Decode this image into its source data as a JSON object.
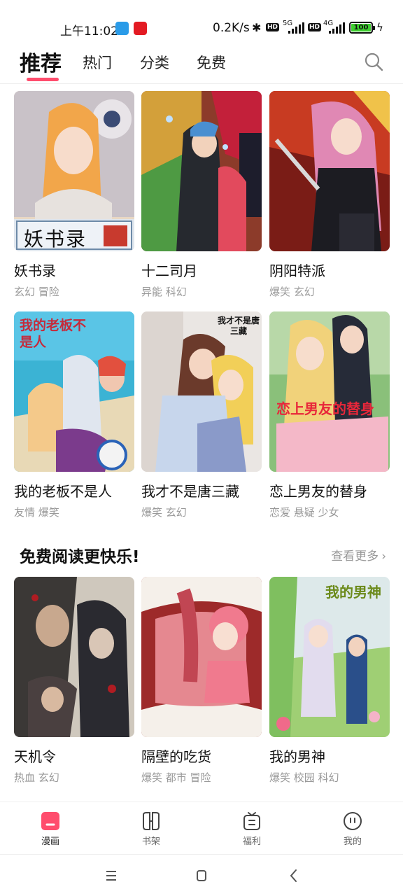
{
  "status_bar": {
    "time": "上午11:02",
    "net_speed": "0.2K/s",
    "battery": "100",
    "network_1": "5G",
    "network_2": "4G",
    "hd": "HD"
  },
  "tabs": {
    "items": [
      "推荐",
      "热门",
      "分类",
      "免费"
    ],
    "active": "推荐"
  },
  "grid": [
    {
      "title": "妖书录",
      "tags": "玄幻 冒险",
      "cover_text": "妖书录"
    },
    {
      "title": "十二司月",
      "tags": "异能 科幻",
      "cover_text": ""
    },
    {
      "title": "阴阳特派",
      "tags": "爆笑 玄幻",
      "cover_text": ""
    },
    {
      "title": "我的老板不是人",
      "tags": "友情 爆笑",
      "cover_text": "我的老板不是人"
    },
    {
      "title": "我才不是唐三藏",
      "tags": "爆笑 玄幻",
      "cover_text": "我才不是唐三藏"
    },
    {
      "title": "恋上男友的替身",
      "tags": "恋爱 悬疑 少女",
      "cover_text": "恋上男友的替身"
    }
  ],
  "free_section": {
    "title": "免费阅读更快乐!",
    "more": "查看更多",
    "items": [
      {
        "title": "天机令",
        "tags": "热血 玄幻"
      },
      {
        "title": "隔壁的吃货",
        "tags": "爆笑 都市 冒险"
      },
      {
        "title": "我的男神",
        "tags": "爆笑 校园 科幻",
        "cover_text": "我的男神"
      }
    ]
  },
  "bottom_nav": {
    "items": [
      {
        "label": "漫画",
        "icon": "comic-icon"
      },
      {
        "label": "书架",
        "icon": "bookshelf-icon"
      },
      {
        "label": "福利",
        "icon": "gift-icon"
      },
      {
        "label": "我的",
        "icon": "profile-icon"
      }
    ],
    "active": "漫画",
    "accent": "#ff4d6d"
  }
}
